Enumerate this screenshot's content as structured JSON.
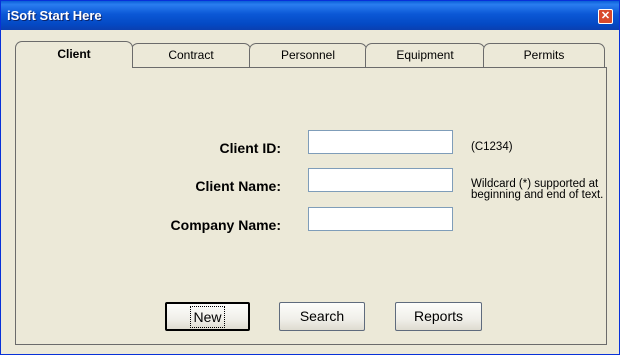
{
  "window": {
    "title": "iSoft Start Here"
  },
  "tabs": [
    {
      "label": "Client",
      "active": true
    },
    {
      "label": "Contract",
      "active": false
    },
    {
      "label": "Personnel",
      "active": false
    },
    {
      "label": "Equipment",
      "active": false
    },
    {
      "label": "Permits",
      "active": false
    }
  ],
  "form": {
    "client_id": {
      "label": "Client ID:",
      "value": "",
      "hint": "(C1234)"
    },
    "client_name": {
      "label": "Client Name:",
      "value": ""
    },
    "company_name": {
      "label": "Company Name:",
      "value": ""
    },
    "wildcard_hint": "Wildcard (*) supported at beginning and end of text."
  },
  "buttons": {
    "new": "New",
    "search": "Search",
    "reports": "Reports"
  }
}
